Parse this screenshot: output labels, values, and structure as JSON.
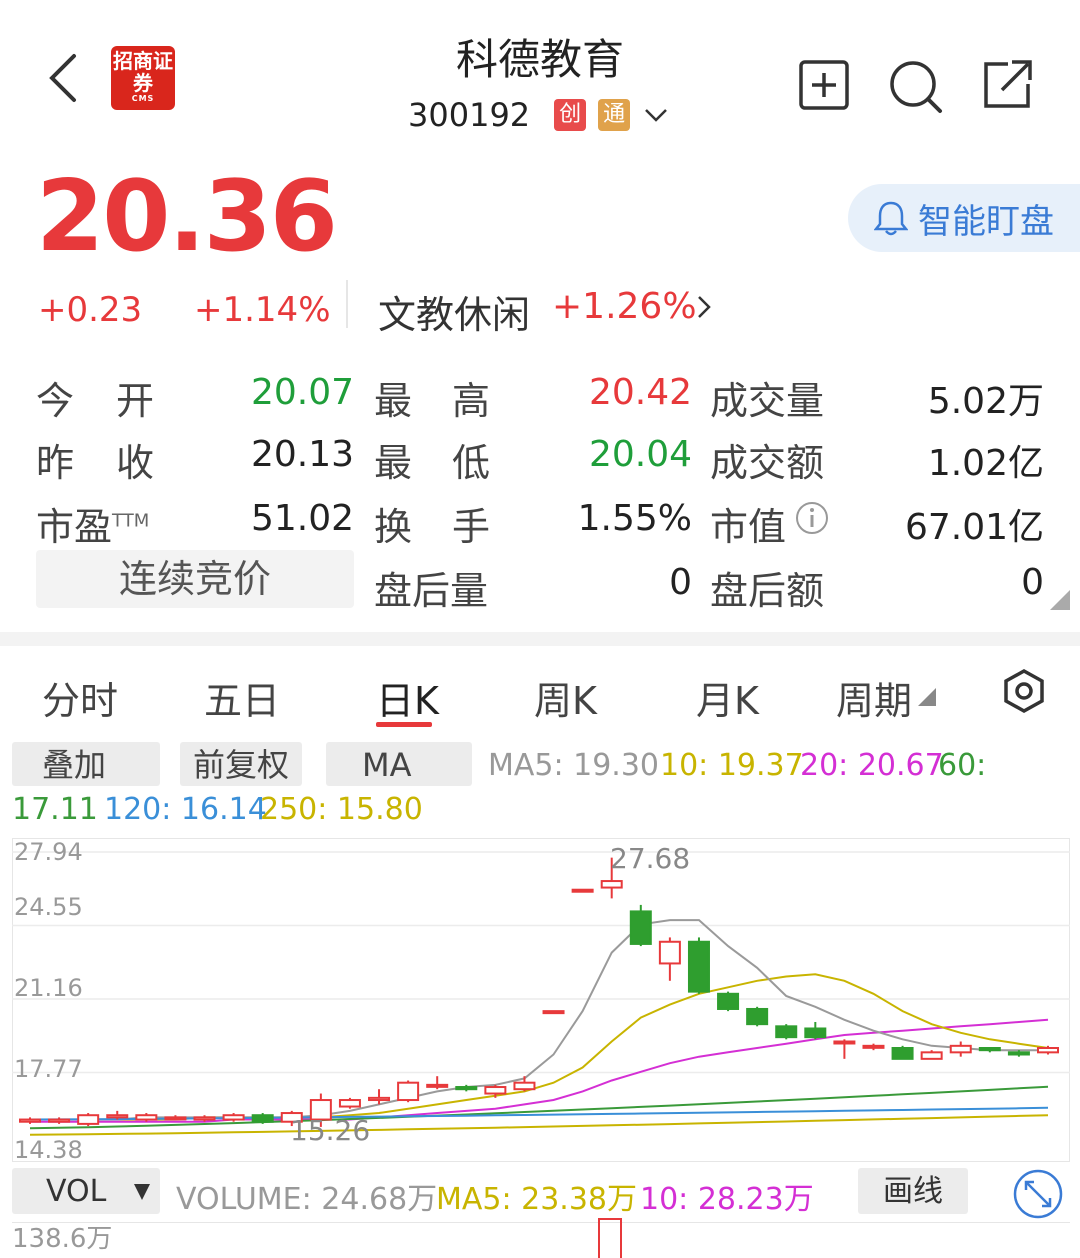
{
  "header": {
    "logo_text": "招商证券",
    "logo_sub": "CMS",
    "stock_name": "科德教育",
    "stock_code": "300192",
    "tag_1": "创",
    "tag_2": "通"
  },
  "quote": {
    "price": "20.36",
    "change": "+0.23",
    "change_pct": "+1.14%",
    "sector_name": "文教休闲",
    "sector_pct": "+1.26%",
    "watch_label": "智能盯盘"
  },
  "stats": {
    "open_label_a": "今",
    "open_label_b": "开",
    "open": "20.07",
    "high_label_a": "最",
    "high_label_b": "高",
    "high": "20.42",
    "volume_label": "成交量",
    "volume": "5.02万",
    "prev_label_a": "昨",
    "prev_label_b": "收",
    "prev_close": "20.13",
    "low_label_a": "最",
    "low_label_b": "低",
    "low": "20.04",
    "turnover_label": "成交额",
    "turnover": "1.02亿",
    "pe_label": "市盈",
    "pe_sup": "TTM",
    "pe": "51.02",
    "turnrate_label_a": "换",
    "turnrate_label_b": "手",
    "turnover_rate": "1.55%",
    "mcap_label": "市值",
    "market_cap": "67.01亿",
    "auction_label": "连续竞价",
    "after_vol_label": "盘后量",
    "after_vol": "0",
    "after_amt_label": "盘后额",
    "after_amt": "0"
  },
  "tabs": [
    "分时",
    "五日",
    "日K",
    "周K",
    "月K",
    "周期"
  ],
  "active_tab": "日K",
  "indicator": {
    "overlay_label": "叠加",
    "adjust_label": "前复权",
    "ma_label": "MA",
    "ma5": "MA5: 19.30",
    "ma10": "10: 19.37",
    "ma20": "20: 20.67",
    "ma60": "60:",
    "ma60_val": "17.11",
    "ma120": "120: 16.14",
    "ma250": "250: 15.80"
  },
  "volume_bar": {
    "vol_label": "VOL",
    "volume": "VOLUME: 24.68万",
    "ma5": "MA5: 23.38万",
    "ma10": "10: 28.23万",
    "draw_label": "画线",
    "axis_top": "138.6万"
  },
  "colors": {
    "up": "#e7393b",
    "down": "#2f9e2f",
    "ma5": "#9a9a9a",
    "ma10": "#c8b400",
    "ma20": "#d42fd4",
    "ma60": "#3a9a3a",
    "ma120": "#3a8fd8",
    "ma250": "#c8b400"
  },
  "chart_data": {
    "type": "candlestick",
    "y_ticks": [
      "27.94",
      "24.55",
      "21.16",
      "17.77",
      "14.38"
    ],
    "ylim": [
      14.38,
      27.94
    ],
    "high_label": "27.68",
    "low_label": "15.26",
    "candles": [
      {
        "o": 15.5,
        "c": 15.6,
        "h": 15.7,
        "l": 15.4
      },
      {
        "o": 15.5,
        "c": 15.6,
        "h": 15.7,
        "l": 15.4
      },
      {
        "o": 15.4,
        "c": 15.8,
        "h": 15.9,
        "l": 15.3
      },
      {
        "o": 15.7,
        "c": 15.8,
        "h": 16.0,
        "l": 15.6
      },
      {
        "o": 15.6,
        "c": 15.8,
        "h": 15.9,
        "l": 15.5
      },
      {
        "o": 15.7,
        "c": 15.7,
        "h": 15.8,
        "l": 15.6
      },
      {
        "o": 15.6,
        "c": 15.7,
        "h": 15.8,
        "l": 15.5
      },
      {
        "o": 15.6,
        "c": 15.8,
        "h": 15.9,
        "l": 15.5
      },
      {
        "o": 15.8,
        "c": 15.5,
        "h": 15.9,
        "l": 15.4
      },
      {
        "o": 15.5,
        "c": 15.9,
        "h": 16.0,
        "l": 15.3
      },
      {
        "o": 15.6,
        "c": 16.5,
        "h": 16.8,
        "l": 15.26
      },
      {
        "o": 16.2,
        "c": 16.5,
        "h": 16.6,
        "l": 16.1
      },
      {
        "o": 16.5,
        "c": 16.6,
        "h": 17.0,
        "l": 16.3
      },
      {
        "o": 16.5,
        "c": 17.3,
        "h": 17.4,
        "l": 16.4
      },
      {
        "o": 17.2,
        "c": 17.2,
        "h": 17.6,
        "l": 17.0
      },
      {
        "o": 17.1,
        "c": 17.0,
        "h": 17.2,
        "l": 16.9
      },
      {
        "o": 16.8,
        "c": 17.1,
        "h": 17.2,
        "l": 16.6
      },
      {
        "o": 17.0,
        "c": 17.3,
        "h": 17.6,
        "l": 16.9
      },
      {
        "o": 20.6,
        "c": 20.6,
        "h": 20.6,
        "l": 20.6
      },
      {
        "o": 26.2,
        "c": 26.2,
        "h": 26.2,
        "l": 26.2
      },
      {
        "o": 26.3,
        "c": 26.6,
        "h": 27.68,
        "l": 25.8
      },
      {
        "o": 25.2,
        "c": 23.7,
        "h": 25.5,
        "l": 23.6
      },
      {
        "o": 22.8,
        "c": 23.8,
        "h": 24.0,
        "l": 22.0
      },
      {
        "o": 23.8,
        "c": 21.5,
        "h": 24.0,
        "l": 21.4
      },
      {
        "o": 21.4,
        "c": 20.7,
        "h": 21.5,
        "l": 20.6
      },
      {
        "o": 20.7,
        "c": 20.0,
        "h": 20.8,
        "l": 19.9
      },
      {
        "o": 19.9,
        "c": 19.4,
        "h": 20.0,
        "l": 19.3
      },
      {
        "o": 19.8,
        "c": 19.4,
        "h": 20.1,
        "l": 19.3
      },
      {
        "o": 19.2,
        "c": 19.2,
        "h": 19.3,
        "l": 18.4
      },
      {
        "o": 19.0,
        "c": 19.0,
        "h": 19.1,
        "l": 18.8
      },
      {
        "o": 18.9,
        "c": 18.4,
        "h": 19.0,
        "l": 18.4
      },
      {
        "o": 18.4,
        "c": 18.7,
        "h": 18.8,
        "l": 18.4
      },
      {
        "o": 18.7,
        "c": 19.0,
        "h": 19.2,
        "l": 18.5
      },
      {
        "o": 18.9,
        "c": 18.8,
        "h": 18.9,
        "l": 18.7
      },
      {
        "o": 18.7,
        "c": 18.6,
        "h": 18.8,
        "l": 18.5
      },
      {
        "o": 18.7,
        "c": 18.9,
        "h": 19.0,
        "l": 18.6
      }
    ],
    "ma5": [
      15.6,
      15.6,
      15.6,
      15.6,
      15.7,
      15.7,
      15.7,
      15.7,
      15.7,
      15.7,
      15.8,
      16.0,
      16.3,
      16.6,
      16.9,
      17.1,
      17.2,
      17.5,
      18.6,
      20.6,
      23.3,
      24.6,
      24.8,
      24.8,
      23.6,
      22.6,
      21.3,
      20.8,
      20.2,
      19.7,
      19.3,
      19.0,
      18.9,
      18.8,
      18.8,
      18.8
    ],
    "ma10": [
      15.6,
      15.6,
      15.6,
      15.6,
      15.6,
      15.6,
      15.7,
      15.7,
      15.7,
      15.7,
      15.7,
      15.8,
      15.9,
      16.1,
      16.3,
      16.5,
      16.7,
      16.9,
      17.3,
      18.0,
      19.2,
      20.3,
      20.9,
      21.4,
      21.7,
      22.0,
      22.2,
      22.3,
      22.0,
      21.4,
      20.6,
      20.0,
      19.6,
      19.3,
      19.1,
      18.9
    ],
    "ma20": [
      15.5,
      15.5,
      15.5,
      15.5,
      15.5,
      15.5,
      15.5,
      15.6,
      15.6,
      15.6,
      15.6,
      15.6,
      15.7,
      15.8,
      15.9,
      16.0,
      16.1,
      16.3,
      16.5,
      16.9,
      17.4,
      17.8,
      18.2,
      18.5,
      18.7,
      18.9,
      19.1,
      19.3,
      19.5,
      19.6,
      19.7,
      19.8,
      19.9,
      20.0,
      20.1,
      20.2
    ]
  }
}
